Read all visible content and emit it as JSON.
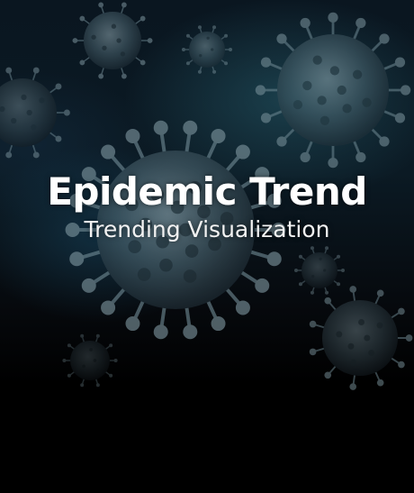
{
  "poster": {
    "title": "Epidemic Trend",
    "subtitle": "Trending Visualization"
  },
  "icons": {
    "virus": "virus-icon"
  },
  "colors": {
    "background": "#000000",
    "virus_tint": "#5f7f8c",
    "text": "#ffffff"
  }
}
